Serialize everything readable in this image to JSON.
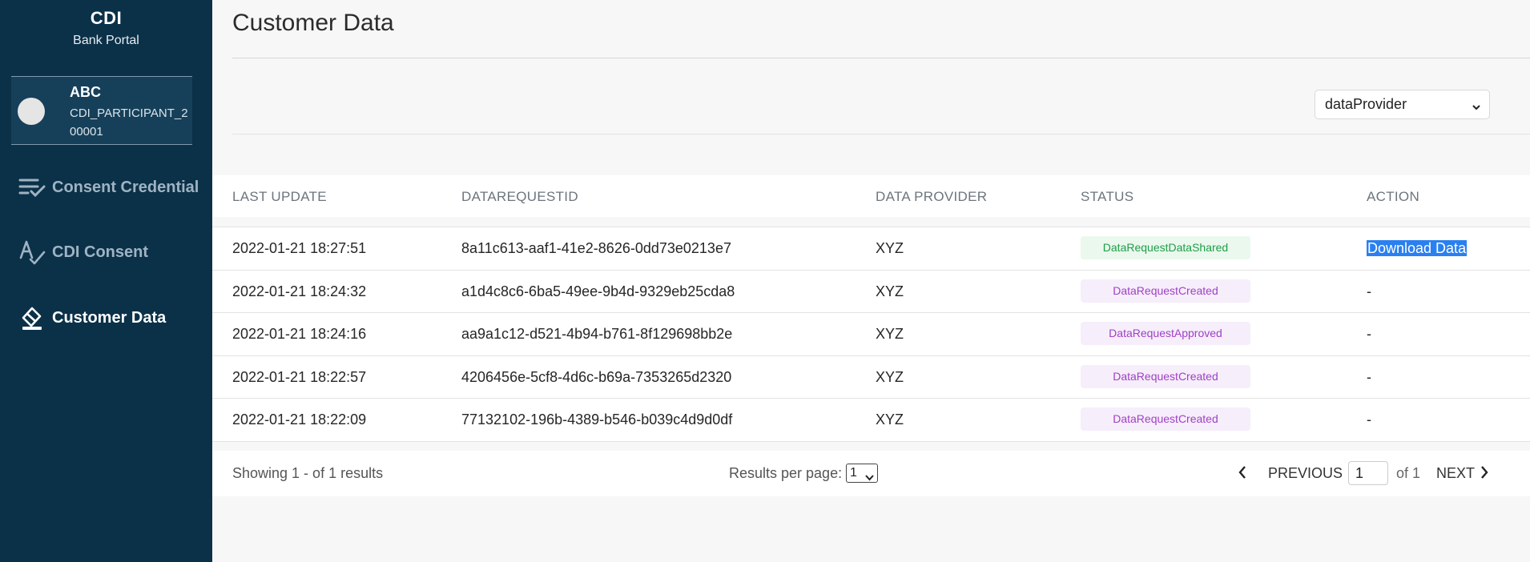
{
  "sidebar": {
    "brand_title": "CDI",
    "brand_sub": "Bank Portal",
    "user": {
      "name": "ABC",
      "id": "CDI_PARTICIPANT_200001"
    },
    "items": [
      {
        "label": "Consent Credential",
        "icon": "checklist-icon",
        "active": false
      },
      {
        "label": "CDI Consent",
        "icon": "signature-check-icon",
        "active": false
      },
      {
        "label": "Customer Data",
        "icon": "eraser-icon",
        "active": true
      }
    ]
  },
  "main": {
    "title": "Customer Data",
    "filter": {
      "value": "dataProvider"
    },
    "table": {
      "headers": [
        "LAST UPDATE",
        "DATAREQUESTID",
        "DATA PROVIDER",
        "STATUS",
        "ACTION"
      ],
      "rows": [
        {
          "last_update": "2022-01-21 18:27:51",
          "id": "8a11c613-aaf1-41e2-8626-0dd73e0213e7",
          "provider": "XYZ",
          "status": "DataRequestDataShared",
          "action": "Download Data"
        },
        {
          "last_update": "2022-01-21 18:24:32",
          "id": "a1d4c8c6-6ba5-49ee-9b4d-9329eb25cda8",
          "provider": "XYZ",
          "status": "DataRequestCreated",
          "action": "-"
        },
        {
          "last_update": "2022-01-21 18:24:16",
          "id": "aa9a1c12-d521-4b94-b761-8f129698bb2e",
          "provider": "XYZ",
          "status": "DataRequestApproved",
          "action": "-"
        },
        {
          "last_update": "2022-01-21 18:22:57",
          "id": "4206456e-5cf8-4d6c-b69a-7353265d2320",
          "provider": "XYZ",
          "status": "DataRequestCreated",
          "action": "-"
        },
        {
          "last_update": "2022-01-21 18:22:09",
          "id": "77132102-196b-4389-b546-b039c4d9d0df",
          "provider": "XYZ",
          "status": "DataRequestCreated",
          "action": "-"
        }
      ]
    },
    "footer": {
      "showing": "Showing 1 - of 1 results",
      "rpp_label": "Results per page:",
      "rpp_value": "1",
      "prev": "PREVIOUS",
      "page": "1",
      "of": "of 1",
      "next": "NEXT"
    }
  },
  "colors": {
    "sidebar_bg": "#0b3149",
    "badge_green": "#1e9e47",
    "badge_purple": "#a040c5",
    "link_highlight": "#2a80f0"
  }
}
